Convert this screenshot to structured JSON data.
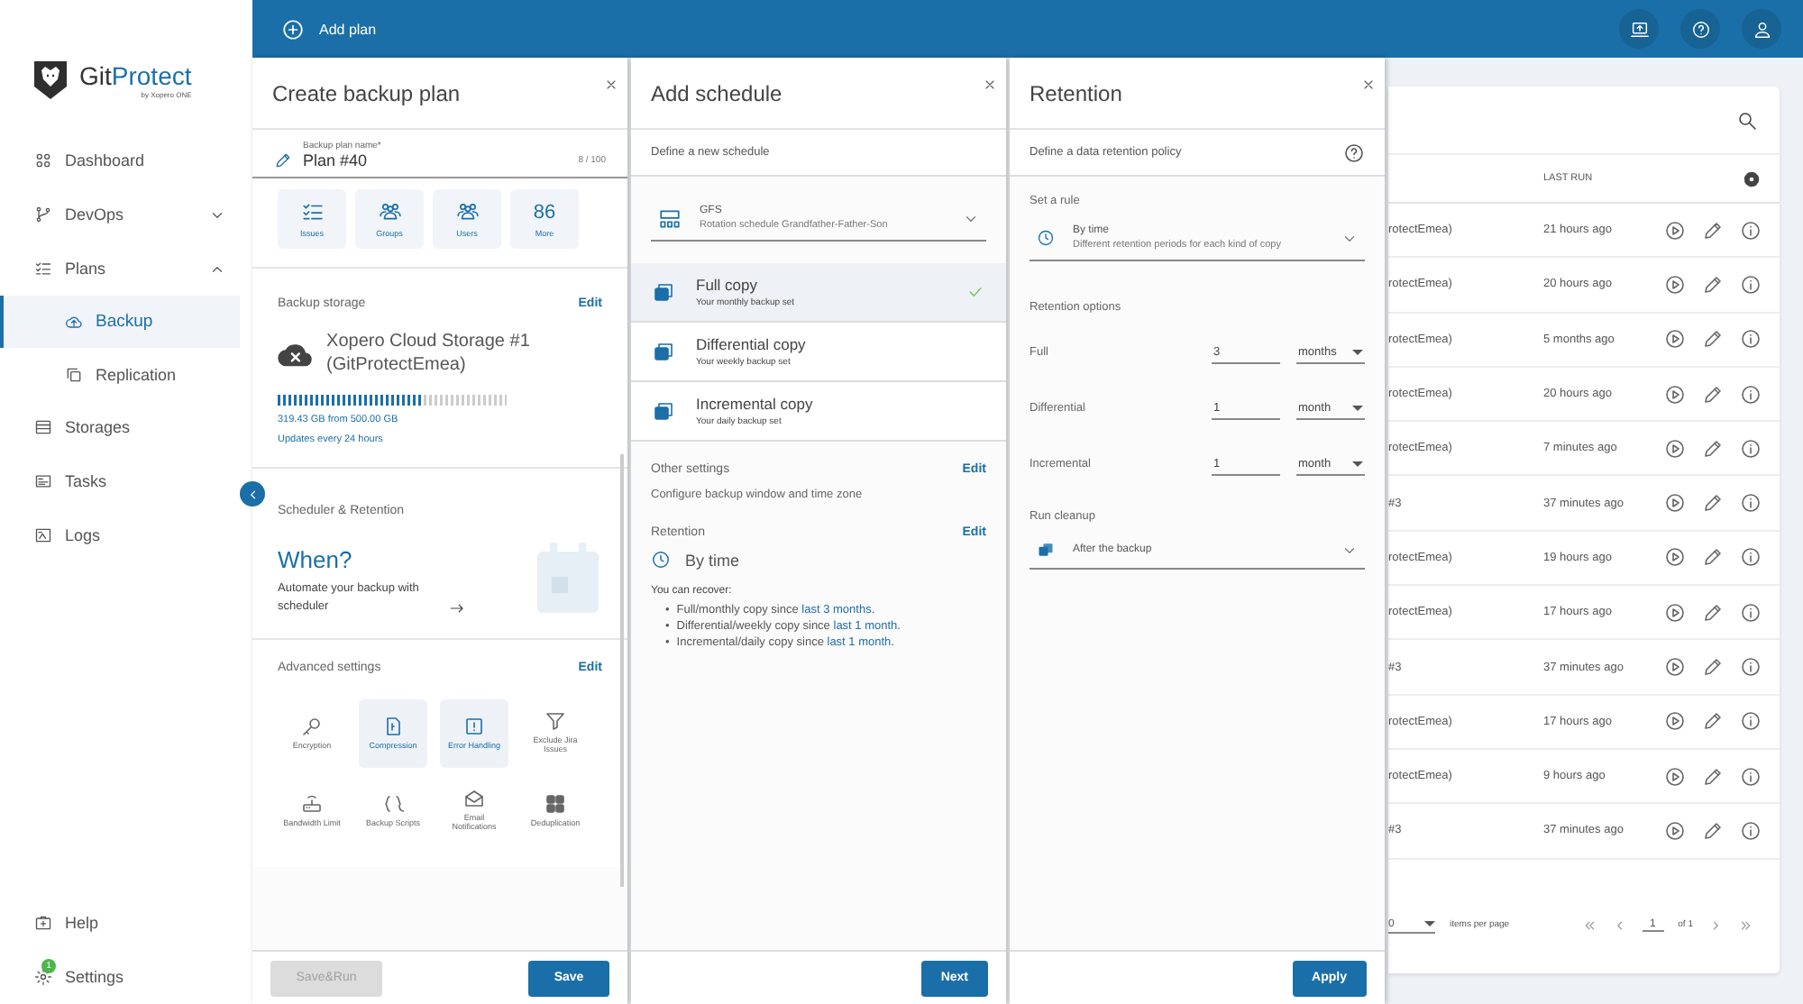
{
  "sidebar": {
    "logo": {
      "name_start": "Git",
      "name_end": "Protect",
      "tagline": "by Xopero ONE"
    },
    "items": [
      {
        "label": "Dashboard",
        "selected": false
      },
      {
        "label": "DevOps",
        "selected": false,
        "expanded": false
      },
      {
        "label": "Plans",
        "selected": false,
        "expanded": true,
        "children": [
          {
            "label": "Backup",
            "selected": true
          },
          {
            "label": "Replication",
            "selected": false
          }
        ]
      },
      {
        "label": "Storages",
        "selected": false
      },
      {
        "label": "Tasks",
        "selected": false
      },
      {
        "label": "Logs",
        "selected": false
      }
    ],
    "bottom": [
      {
        "label": "Help",
        "selected": false
      },
      {
        "label": "Settings",
        "selected": false,
        "badge": "1"
      }
    ]
  },
  "topbar": {
    "action": "Add plan"
  },
  "create_plan": {
    "title": "Create backup plan",
    "name_field": {
      "label": "Backup plan name*",
      "value": "Plan #40",
      "counter": "8 / 100"
    },
    "scopes": [
      {
        "kind": "issues",
        "label": "Issues"
      },
      {
        "kind": "groups",
        "label": "Groups"
      },
      {
        "kind": "users",
        "label": "Users"
      },
      {
        "kind": "count",
        "count": "86",
        "label": "More"
      }
    ],
    "storage": {
      "heading": "Backup storage",
      "edit": "Edit",
      "name": "Xopero Cloud Storage #1 (GitProtectEmea)",
      "level": 0.64,
      "usage": "319.43 GB from 500.00 GB",
      "updates": "Updates every 24 hours"
    },
    "scheduler": {
      "heading": "Scheduler & Retention",
      "title": "When?",
      "text": "Automate your backup with scheduler"
    },
    "advanced": {
      "heading": "Advanced settings",
      "edit": "Edit",
      "options": [
        {
          "label": "Encryption",
          "selected": false
        },
        {
          "label": "Compression",
          "selected": true
        },
        {
          "label": "Error Handling",
          "selected": true
        },
        {
          "label": "Exclude Jira Issues",
          "selected": false
        },
        {
          "label": "Bandwidth Limit",
          "selected": false
        },
        {
          "label": "Backup Scripts",
          "selected": false
        },
        {
          "label": "Email Notifications",
          "selected": false
        },
        {
          "label": "Deduplication",
          "selected": false
        }
      ]
    },
    "buttons": [
      {
        "label": "Save&Run",
        "disabled": true
      },
      {
        "label": "Save",
        "disabled": false
      }
    ]
  },
  "add_schedule": {
    "title": "Add schedule",
    "subtitle": "Define a new schedule",
    "schedule_select": {
      "value": "GFS",
      "description": "Rotation schedule Grandfather-Father-Son"
    },
    "copies": [
      {
        "title": "Full copy",
        "description": "Your monthly backup set",
        "selected": true
      },
      {
        "title": "Differential copy",
        "description": "Your weekly backup set",
        "selected": false
      },
      {
        "title": "Incremental copy",
        "description": "Your daily backup set",
        "selected": false
      }
    ],
    "other_settings": {
      "heading": "Other settings",
      "edit": "Edit",
      "text": "Configure backup window and time zone"
    },
    "retention": {
      "heading": "Retention",
      "edit": "Edit",
      "rule": "By time",
      "intro": "You can recover:",
      "items": [
        {
          "marker": "•",
          "text": "Full/monthly copy since",
          "link": "last 3 months."
        },
        {
          "marker": "•",
          "text": "Differential/weekly copy since",
          "link": "last 1 month."
        },
        {
          "marker": "•",
          "text": "Incremental/daily copy since",
          "link": "last 1 month."
        }
      ]
    },
    "button": "Next"
  },
  "retention": {
    "title": "Retention",
    "subtitle": "Define a data retention policy",
    "rule_heading": "Set a rule",
    "rule_select": {
      "value": "By time",
      "description": "Different retention periods for each kind of copy"
    },
    "options_heading": "Retention options",
    "rows": [
      {
        "label": "Full",
        "amount": "3",
        "unit": "months"
      },
      {
        "label": "Differential",
        "amount": "1",
        "unit": "month"
      },
      {
        "label": "Incremental",
        "amount": "1",
        "unit": "month"
      }
    ],
    "cleanup_heading": "Run cleanup",
    "cleanup_select": {
      "value": "After the backup"
    },
    "button": "Apply"
  },
  "table": {
    "columns": [
      "LAST RUN"
    ],
    "rows": [
      {
        "name": "rotectEmea)",
        "last_run": "21 hours ago"
      },
      {
        "name": "rotectEmea)",
        "last_run": "20 hours ago"
      },
      {
        "name": "rotectEmea)",
        "last_run": "5 months ago"
      },
      {
        "name": "rotectEmea)",
        "last_run": "20 hours ago"
      },
      {
        "name": "rotectEmea)",
        "last_run": "7 minutes ago"
      },
      {
        "name": "#3",
        "last_run": "37 minutes ago"
      },
      {
        "name": "rotectEmea)",
        "last_run": "19 hours ago"
      },
      {
        "name": "rotectEmea)",
        "last_run": "17 hours ago"
      },
      {
        "name": "#3",
        "last_run": "37 minutes ago"
      },
      {
        "name": "rotectEmea)",
        "last_run": "17 hours ago"
      },
      {
        "name": "rotectEmea)",
        "last_run": "9 hours ago"
      },
      {
        "name": "#3",
        "last_run": "37 minutes ago"
      }
    ],
    "pagination": {
      "page_size": "0",
      "items_label": "items per page",
      "page": "1",
      "of": "of 1"
    }
  }
}
